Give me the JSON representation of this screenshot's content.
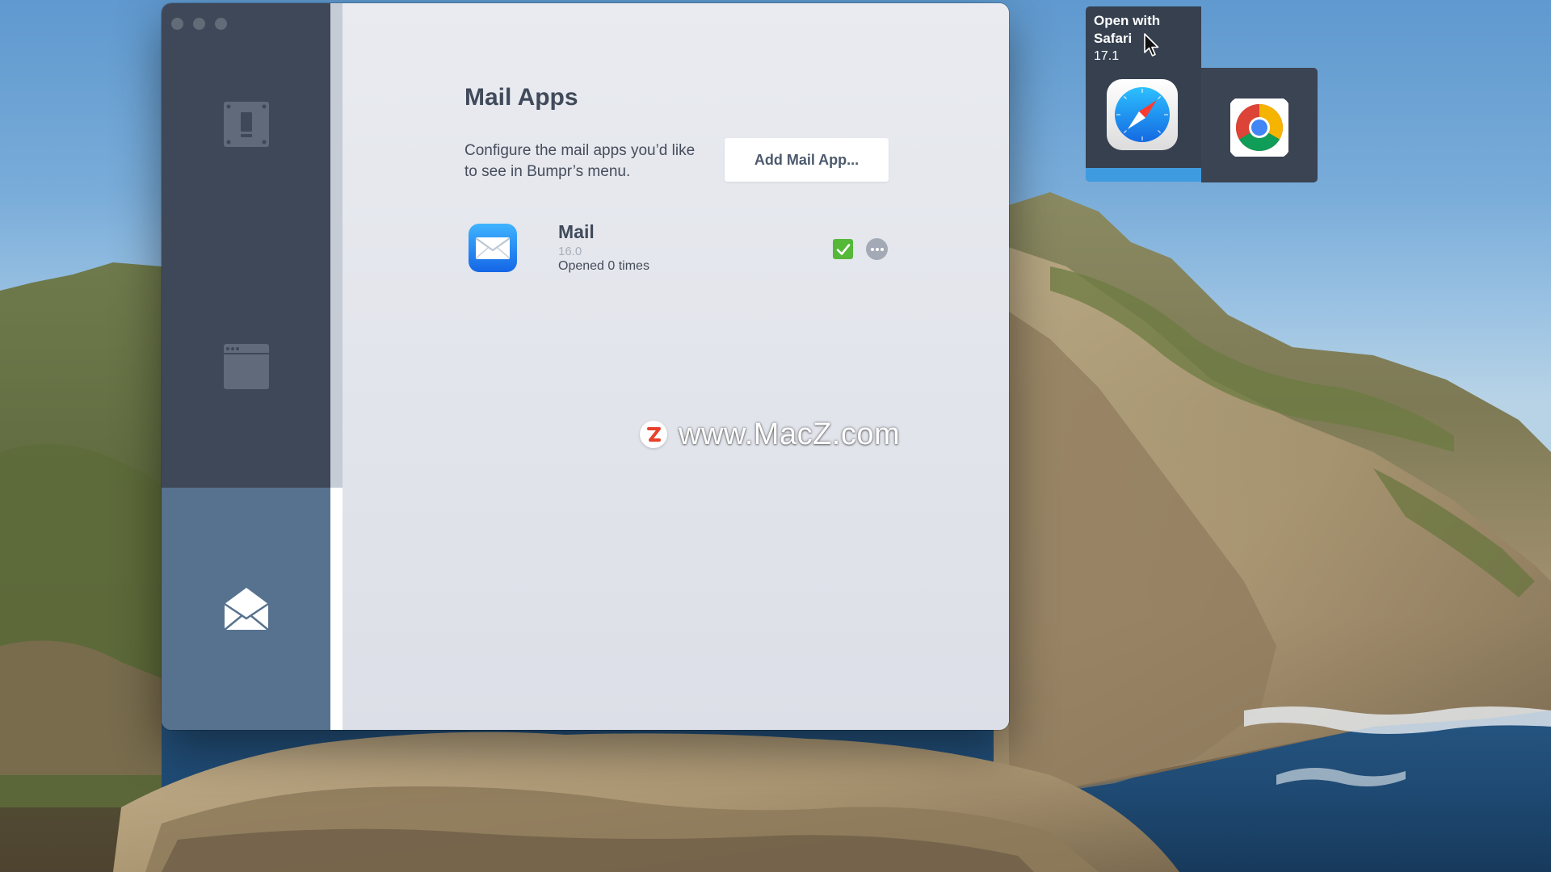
{
  "window": {
    "title": "Mail Apps",
    "description": "Configure the mail apps you’d like to see in Bumpr’s menu.",
    "add_button_label": "Add Mail App..."
  },
  "sidebar": {
    "items": [
      {
        "name": "browsers",
        "icon": "phone-icon",
        "active": false
      },
      {
        "name": "window",
        "icon": "browser-window-icon",
        "active": false
      },
      {
        "name": "mail",
        "icon": "envelope-icon",
        "active": true
      }
    ]
  },
  "mail_apps": [
    {
      "name": "Mail",
      "version": "16.0",
      "opened": "Opened 0 times",
      "enabled": true,
      "icon": "mail-app-icon"
    }
  ],
  "chooser": {
    "tooltip_label": "Open with Safari",
    "tooltip_version": "17.1",
    "apps": [
      {
        "name": "Safari",
        "icon": "safari-icon",
        "selected": true
      },
      {
        "name": "Chrome",
        "icon": "chrome-icon",
        "selected": false
      }
    ]
  },
  "watermark": {
    "text": "www.MacZ.com",
    "logo_letter": "Z"
  },
  "colors": {
    "sidebar_bg": "#3f4859",
    "sidebar_active": "#57728f",
    "checkbox_green": "#55b839",
    "selection_blue": "#3f9be0"
  }
}
